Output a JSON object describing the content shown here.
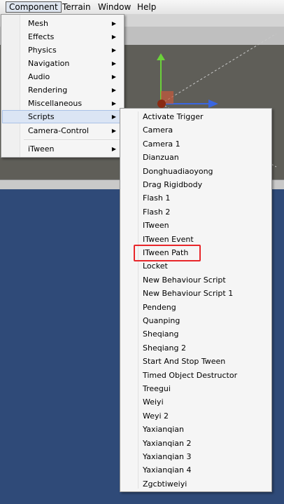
{
  "menubar": {
    "items": [
      {
        "label": "Component",
        "active": true
      },
      {
        "label": "Terrain"
      },
      {
        "label": "Window"
      },
      {
        "label": "Help"
      }
    ]
  },
  "component_menu": {
    "items": [
      {
        "label": "Mesh",
        "has_submenu": true
      },
      {
        "label": "Effects",
        "has_submenu": true
      },
      {
        "label": "Physics",
        "has_submenu": true
      },
      {
        "label": "Navigation",
        "has_submenu": true
      },
      {
        "label": "Audio",
        "has_submenu": true
      },
      {
        "label": "Rendering",
        "has_submenu": true
      },
      {
        "label": "Miscellaneous",
        "has_submenu": true
      },
      {
        "label": "Scripts",
        "has_submenu": true,
        "highlighted": true
      },
      {
        "label": "Camera-Control",
        "has_submenu": true
      },
      {
        "label": "iTween",
        "has_submenu": true
      }
    ],
    "arrow_glyph": "▶"
  },
  "scripts_submenu": {
    "items": [
      "Activate Trigger",
      "Camera",
      "Camera 1",
      "Dianzuan",
      "Donghuadiaoyong",
      "Drag Rigidbody",
      "Flash 1",
      "Flash 2",
      "ITween",
      "ITween Event",
      "ITween Path",
      "Locket",
      "New Behaviour Script",
      "New Behaviour Script 1",
      "Pendeng",
      "Quanping",
      "Sheqiang",
      "Sheqiang 2",
      "Start And Stop Tween",
      "Timed Object Destructor",
      "Treegui",
      "Weiyi",
      "Weyi 2",
      "Yaxianqian",
      "Yaxianqian 2",
      "Yaxianqian 3",
      "Yaxianqian 4",
      "Zgcbtiweiyi"
    ],
    "annotated_item": "ITween Path"
  },
  "colors": {
    "annotation": "#e8262a",
    "highlight_bg": "#dbe5f4",
    "lower_panel": "#2f4a78",
    "scene_bg": "#5f5e58"
  }
}
